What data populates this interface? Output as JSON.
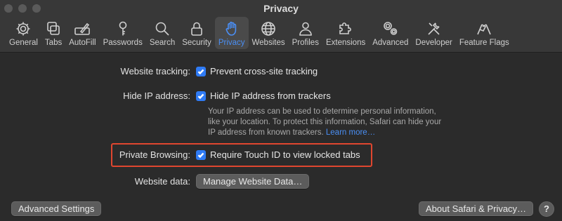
{
  "window": {
    "title": "Privacy"
  },
  "toolbar": {
    "items": [
      {
        "label": "General",
        "icon": "gear-icon"
      },
      {
        "label": "Tabs",
        "icon": "tabs-icon"
      },
      {
        "label": "AutoFill",
        "icon": "pencil-field-icon"
      },
      {
        "label": "Passwords",
        "icon": "key-icon"
      },
      {
        "label": "Search",
        "icon": "search-icon"
      },
      {
        "label": "Security",
        "icon": "lock-icon"
      },
      {
        "label": "Privacy",
        "icon": "hand-icon",
        "active": true
      },
      {
        "label": "Websites",
        "icon": "globe-icon"
      },
      {
        "label": "Profiles",
        "icon": "person-icon"
      },
      {
        "label": "Extensions",
        "icon": "puzzle-icon"
      },
      {
        "label": "Advanced",
        "icon": "gears-icon"
      },
      {
        "label": "Developer",
        "icon": "tools-icon"
      },
      {
        "label": "Feature Flags",
        "icon": "flags-icon"
      }
    ]
  },
  "settings": {
    "website_tracking": {
      "label": "Website tracking:",
      "option": "Prevent cross-site tracking",
      "checked": true
    },
    "hide_ip": {
      "label": "Hide IP address:",
      "option": "Hide IP address from trackers",
      "checked": true,
      "description_line1": "Your IP address can be used to determine personal information,",
      "description_line2": "like your location. To protect this information, Safari can hide your",
      "description_line3": "IP address from known trackers.",
      "learn_more": "Learn more…"
    },
    "private_browsing": {
      "label": "Private Browsing:",
      "option": "Require Touch ID to view locked tabs",
      "checked": true
    },
    "website_data": {
      "label": "Website data:",
      "button": "Manage Website Data…"
    }
  },
  "footer": {
    "advanced_button": "Advanced Settings",
    "about_button": "About Safari & Privacy…",
    "help_button": "?"
  },
  "colors": {
    "accent": "#4a8ff5",
    "checkbox": "#2f7bf5",
    "highlight_border": "#e0462f"
  }
}
